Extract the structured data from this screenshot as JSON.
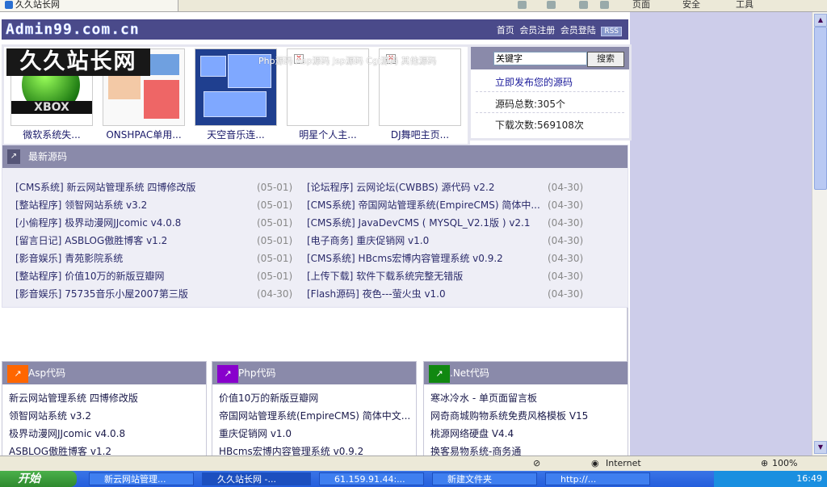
{
  "browser": {
    "tab_title": "久久站长网",
    "cmd_page": "页面",
    "cmd_safety": "安全",
    "cmd_tools": "工具"
  },
  "header": {
    "site_url": "Admin99.com.cn",
    "logo_text": "久久站长网",
    "links": [
      "首页",
      "会员注册",
      "会员登陆"
    ],
    "rss": "RSS",
    "marquee": "Php源码 Asp源码 Jsp源码 Cgi源码 其他源码"
  },
  "featured": [
    {
      "caption": "微软系统失..."
    },
    {
      "caption": "ONSHPAC单用..."
    },
    {
      "caption": "天空音乐连..."
    },
    {
      "caption": "明星个人主..."
    },
    {
      "caption": "DJ舞吧主页..."
    }
  ],
  "sidebar": {
    "search_placeholder": "关键字",
    "search_button": "搜索",
    "publish_link": "立即发布您的源码",
    "total_sources": "源码总数:305个",
    "downloads": "下载次数:569108次"
  },
  "latest": {
    "title": "最新源码",
    "left": [
      {
        "tag": "[CMS系统]",
        "name": "新云网站管理系统 四博修改版",
        "date": "(05-01)"
      },
      {
        "tag": "[整站程序]",
        "name": "领智网站系统 v3.2",
        "date": "(05-01)"
      },
      {
        "tag": "[小偷程序]",
        "name": "极界动漫网JJcomic v4.0.8",
        "date": "(05-01)"
      },
      {
        "tag": "[留言日记]",
        "name": "ASBLOG傲胜博客 v1.2",
        "date": "(05-01)"
      },
      {
        "tag": "[影音娱乐]",
        "name": "青苑影院系统",
        "date": "(05-01)"
      },
      {
        "tag": "[整站程序]",
        "name": "价值10万的新版豆瓣网",
        "date": "(05-01)"
      },
      {
        "tag": "[影音娱乐]",
        "name": "75735音乐小屋2007第三版",
        "date": "(04-30)"
      }
    ],
    "right": [
      {
        "tag": "[论坛程序]",
        "name": "云网论坛(CWBBS) 源代码 v2.2",
        "date": "(04-30)"
      },
      {
        "tag": "[CMS系统]",
        "name": "帝国网站管理系统(EmpireCMS) 简体中...",
        "date": "(04-30)"
      },
      {
        "tag": "[CMS系统]",
        "name": "JavaDevCMS ( MYSQL_V2.1版 ) v2.1",
        "date": "(04-30)"
      },
      {
        "tag": "[电子商务]",
        "name": "重庆促销网 v1.0",
        "date": "(04-30)"
      },
      {
        "tag": "[CMS系统]",
        "name": "HBcms宏博内容管理系统 v0.9.2",
        "date": "(04-30)"
      },
      {
        "tag": "[上传下载]",
        "name": "软件下载系统完整无错版",
        "date": "(04-30)"
      },
      {
        "tag": "[Flash源码]",
        "name": "夜色---萤火虫 v1.0",
        "date": "(04-30)"
      }
    ]
  },
  "categories": [
    {
      "title": "Asp代码",
      "icon_color": "#ff6600",
      "items": [
        "新云网站管理系统 四博修改版",
        "领智网站系统 v3.2",
        "极界动漫网JJcomic v4.0.8",
        "ASBLOG傲胜博客 v1.2"
      ]
    },
    {
      "title": "Php代码",
      "icon_color": "#8800cc",
      "items": [
        "价值10万的新版豆瓣网",
        "帝国网站管理系统(EmpireCMS) 简体中文...",
        "重庆促销网 v1.0",
        "HBcms宏博内容管理系统 v0.9.2"
      ]
    },
    {
      "title": ".Net代码",
      "icon_color": "#118811",
      "items": [
        "寒冰冷水 - 单页面留言板",
        "网奇商城购物系统免费风格模板 V15",
        "桃源网络硬盘 V4.4",
        "换客易物系统-商务通"
      ]
    }
  ],
  "statusbar": {
    "zone": "Internet",
    "zoom": "100%"
  },
  "taskbar": {
    "start": "开始",
    "tasks": [
      "新云网站管理...",
      "久久站长网 -...",
      "61.159.91.44:...",
      "新建文件夹",
      "http://..."
    ],
    "clock": "16:49"
  }
}
